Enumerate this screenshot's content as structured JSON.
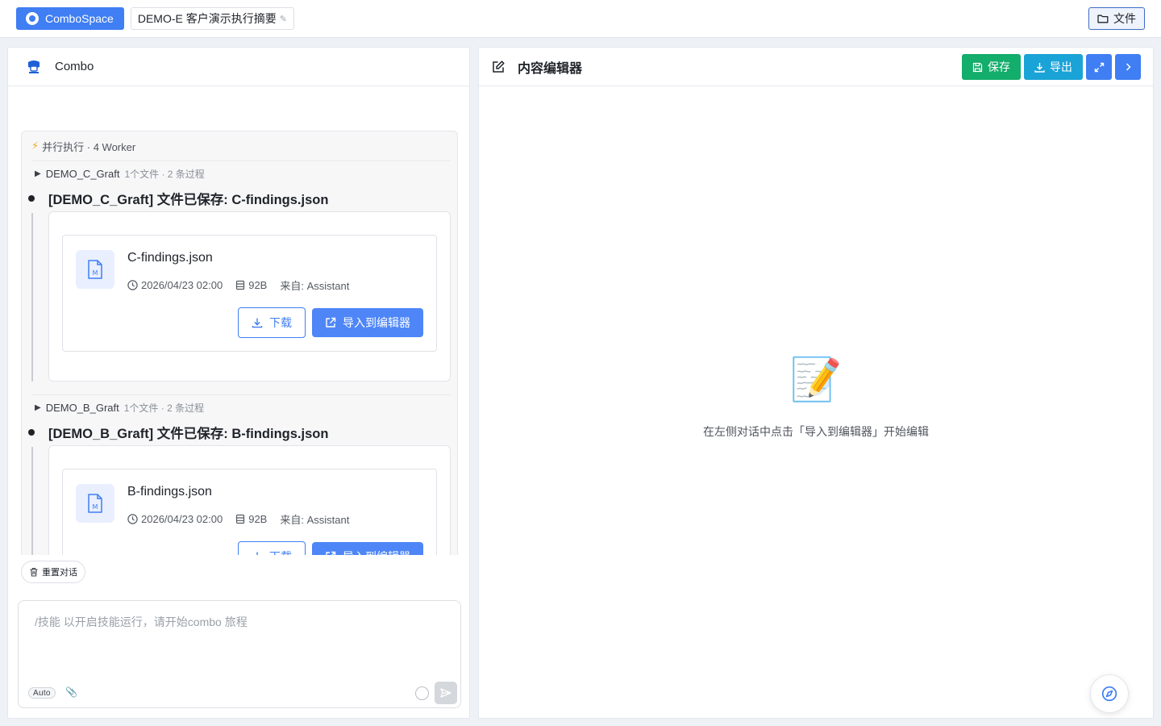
{
  "topbar": {
    "brand": "ComboSpace",
    "project_title": "DEMO-E 客户演示执行摘要",
    "files_label": "文件"
  },
  "chat": {
    "title": "Combo",
    "parallel_label": "并行执行 · 4 Worker",
    "workers": [
      {
        "name": "DEMO_C_Graft",
        "meta": "1个文件 · 2 条过程",
        "message": "[DEMO_C_Graft] 文件已保存: C-findings.json",
        "file": {
          "name": "C-findings.json",
          "time": "2026/04/23 02:00",
          "size": "92B",
          "source": "来自: Assistant"
        }
      },
      {
        "name": "DEMO_B_Graft",
        "meta": "1个文件 · 2 条过程",
        "message": "[DEMO_B_Graft] 文件已保存: B-findings.json",
        "file": {
          "name": "B-findings.json",
          "time": "2026/04/23 02:00",
          "size": "92B",
          "source": "来自: Assistant"
        }
      }
    ],
    "download_label": "下载",
    "import_label": "导入到编辑器",
    "reset_label": "重置对话",
    "input_placeholder": "/技能 以开启技能运行，请开始combo 旅程",
    "input_value": "",
    "mode_tag": "Auto"
  },
  "editor": {
    "title": "内容编辑器",
    "save_label": "保存",
    "export_label": "导出",
    "empty_icon": "📝",
    "empty_hint": "在左侧对话中点击「导入到编辑器」开始编辑"
  },
  "icons": {
    "brand": "combospace-logo-icon",
    "files": "folder-icon",
    "bot": "robot-icon",
    "edit": "edit-icon",
    "save": "save-icon",
    "export": "download-icon",
    "expand": "expand-icon",
    "collapse": "chevron-right-icon",
    "compass": "compass-icon"
  },
  "colors": {
    "primary": "#3f7ef3",
    "save": "#13ad6c",
    "export": "#1aa3d6"
  }
}
